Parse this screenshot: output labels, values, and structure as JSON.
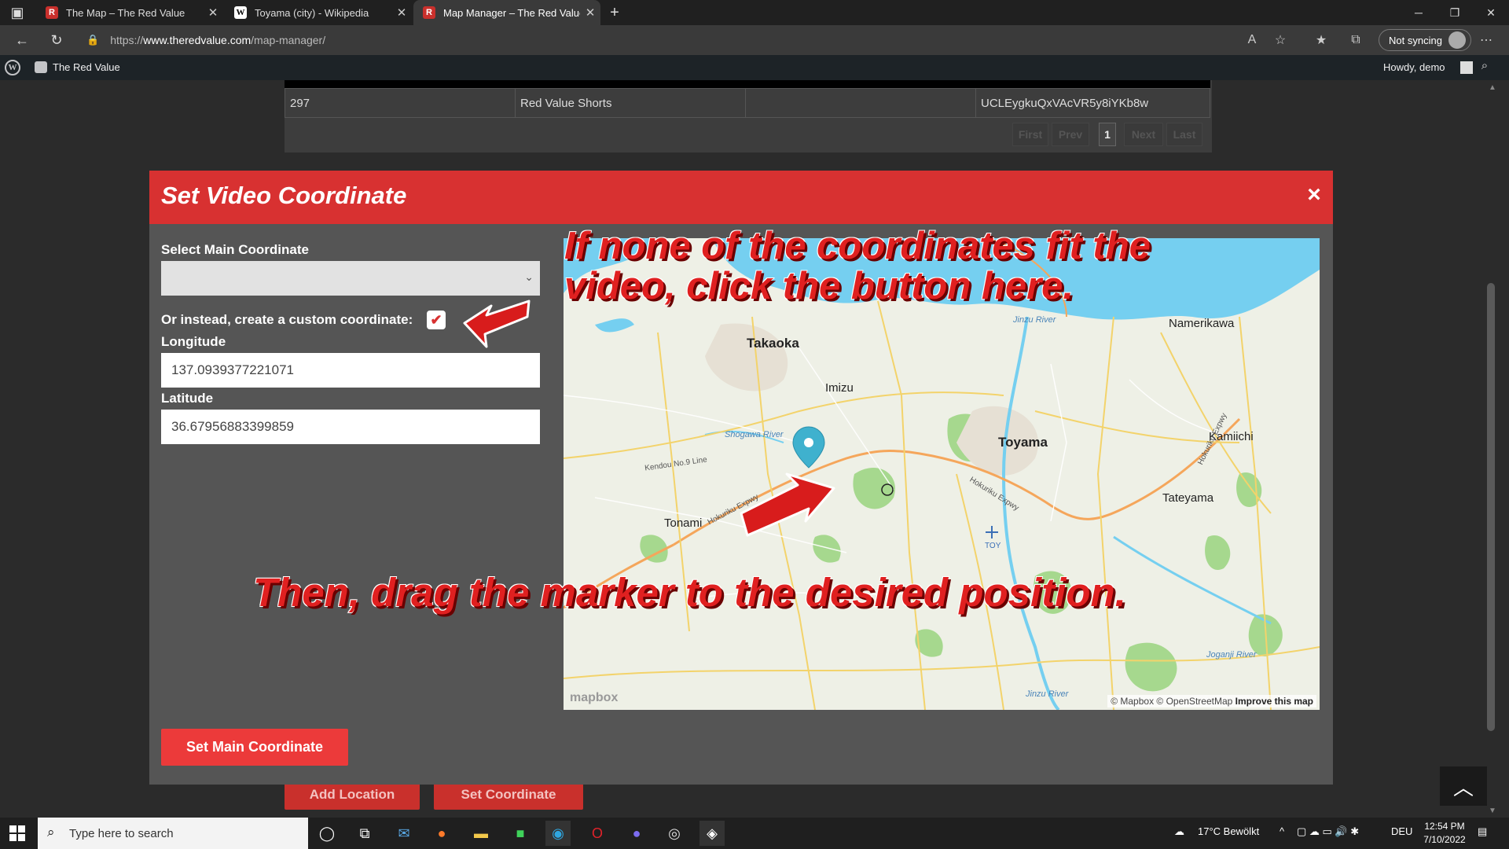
{
  "browser": {
    "tabs": [
      {
        "title": "The Map – The Red Value",
        "favicon": "red-value-icon"
      },
      {
        "title": "Toyama (city) - Wikipedia",
        "favicon": "wikipedia-icon"
      },
      {
        "title": "Map Manager – The Red Value",
        "favicon": "red-value-icon",
        "active": true
      }
    ],
    "url_prefix": "https://",
    "url_domain": "www.theredvalue.com",
    "url_path": "/map-manager/",
    "sync_label": "Not syncing"
  },
  "adminbar": {
    "site_name": "The Red Value",
    "howdy": "Howdy, demo"
  },
  "table": {
    "row": [
      "297",
      "Red Value Shorts",
      "",
      "UCLEygkuQxVAcVR5y8iYKb8w"
    ],
    "pagination": [
      "First",
      "Prev",
      "1",
      "Next",
      "Last"
    ]
  },
  "page_buttons": {
    "add_location": "Add Location",
    "set_coordinate": "Set Coordinate"
  },
  "modal": {
    "title": "Set Video Coordinate",
    "close": "×",
    "select_label": "Select Main Coordinate",
    "select_value": "",
    "custom_label": "Or instead, create a custom coordinate:",
    "custom_checked": true,
    "longitude_label": "Longitude",
    "longitude_value": "137.0939377221071",
    "latitude_label": "Latitude",
    "latitude_value": "36.67956883399859",
    "submit_label": "Set Main Coordinate"
  },
  "map": {
    "places": [
      "Takaoka",
      "Imizu",
      "Toyama",
      "Namerikawa",
      "Kamiichi",
      "Tateyama",
      "Tonami"
    ],
    "rivers": [
      "Jinzu River",
      "Shogawa River",
      "Joganji River",
      "Jinzu River"
    ],
    "roads": [
      "Kendou No.9 Line",
      "Hokuriku Expwy",
      "Hokuriku Expwy",
      "Hokuriku Expwy"
    ],
    "airport_code": "TOY",
    "logo": "mapbox",
    "attribution": "© Mapbox © OpenStreetMap",
    "improve_link": "Improve this map"
  },
  "overlay": {
    "line1": "If none of the coordinates fit the",
    "line2": "video, click the button here.",
    "line3": "Then, drag the marker to the desired position."
  },
  "taskbar": {
    "search_placeholder": "Type here to search",
    "weather": "17°C  Bewölkt",
    "language": "DEU",
    "time": "12:54 PM",
    "date": "7/10/2022"
  },
  "colors": {
    "modal_header": "#d83131",
    "primary_button": "#ec3a3a",
    "overlay_text": "#e02020"
  }
}
